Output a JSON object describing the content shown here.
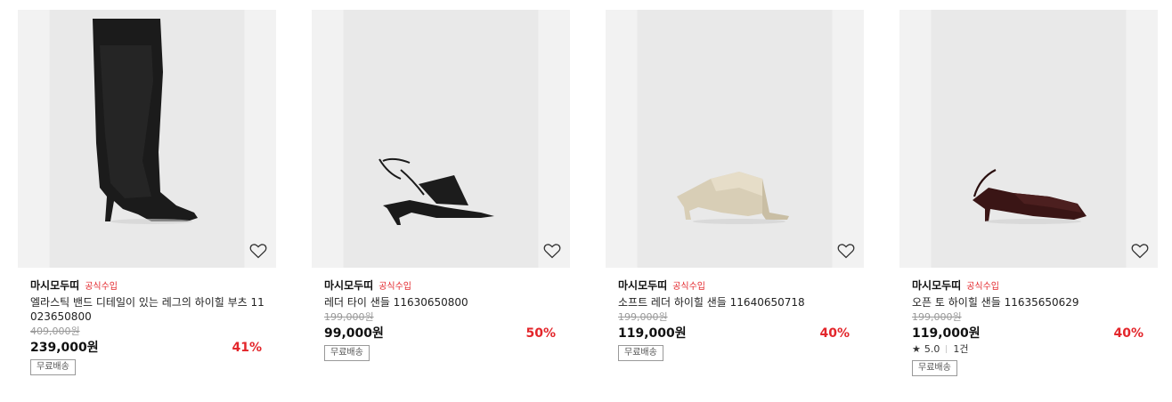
{
  "products": [
    {
      "brand": "마시모두띠",
      "official": "공식수입",
      "title": "엘라스틱 밴드 디테일이 있는 레그의 하이힐 부츠 11023650800",
      "original_price": "409,000원",
      "price": "239,000원",
      "discount": "41%",
      "shipping": "무료배송",
      "wish_icon": "heart-icon"
    },
    {
      "brand": "마시모두띠",
      "official": "공식수입",
      "title": "레더 타이 샌들 11630650800",
      "original_price": "199,000원",
      "price": "99,000원",
      "discount": "50%",
      "shipping": "무료배송",
      "wish_icon": "heart-icon"
    },
    {
      "brand": "마시모두띠",
      "official": "공식수입",
      "title": "소프트 레더 하이힐 샌들 11640650718",
      "original_price": "199,000원",
      "price": "119,000원",
      "discount": "40%",
      "shipping": "무료배송",
      "wish_icon": "heart-icon"
    },
    {
      "brand": "마시모두띠",
      "official": "공식수입",
      "title": "오픈 토 하이힐 샌들 11635650629",
      "original_price": "199,000원",
      "price": "119,000원",
      "discount": "40%",
      "rating": "5.0",
      "review_count": "1건",
      "shipping": "무료배송",
      "wish_icon": "heart-icon"
    }
  ],
  "colors": {
    "accent_red": "#e3262b",
    "text": "#111111",
    "muted": "#999999"
  }
}
